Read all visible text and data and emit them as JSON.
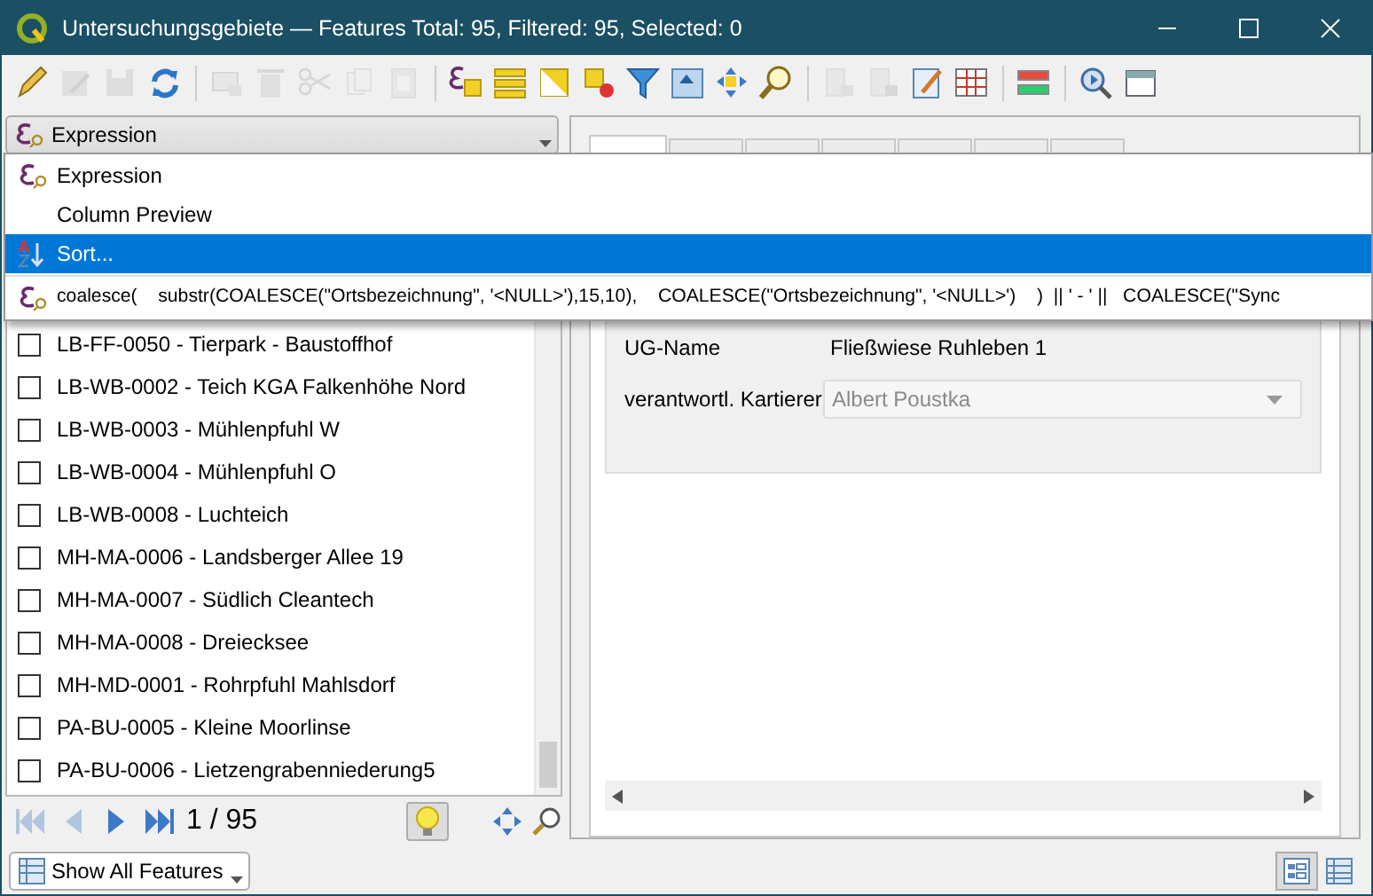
{
  "window": {
    "title": "Untersuchungsgebiete — Features Total: 95, Filtered: 95, Selected: 0"
  },
  "toolbar": [
    {
      "kind": "pencil",
      "disabled": false
    },
    {
      "kind": "edit",
      "disabled": true
    },
    {
      "kind": "save",
      "disabled": true
    },
    {
      "kind": "refresh",
      "disabled": false
    },
    {
      "kind": "sep"
    },
    {
      "kind": "add",
      "disabled": true
    },
    {
      "kind": "trash",
      "disabled": true
    },
    {
      "kind": "cut",
      "disabled": true
    },
    {
      "kind": "copy",
      "disabled": true
    },
    {
      "kind": "paste",
      "disabled": true
    },
    {
      "kind": "sep"
    },
    {
      "kind": "expr",
      "disabled": false
    },
    {
      "kind": "selall",
      "disabled": false
    },
    {
      "kind": "invert",
      "disabled": false
    },
    {
      "kind": "deselect",
      "disabled": false
    },
    {
      "kind": "filter",
      "disabled": false
    },
    {
      "kind": "top",
      "disabled": false
    },
    {
      "kind": "pan",
      "disabled": false
    },
    {
      "kind": "zoom",
      "disabled": false
    },
    {
      "kind": "sep"
    },
    {
      "kind": "newfield",
      "disabled": true
    },
    {
      "kind": "delfield",
      "disabled": true
    },
    {
      "kind": "calc",
      "disabled": false
    },
    {
      "kind": "grid",
      "disabled": false
    },
    {
      "kind": "sep"
    },
    {
      "kind": "cond",
      "disabled": false
    },
    {
      "kind": "sep"
    },
    {
      "kind": "actions",
      "disabled": false
    },
    {
      "kind": "dock",
      "disabled": false
    }
  ],
  "expression_combo": {
    "value": "Expression"
  },
  "menu": [
    {
      "kind": "expr",
      "label": "Expression",
      "selected": false
    },
    {
      "kind": "plain",
      "label": "Column Preview",
      "selected": false
    },
    {
      "kind": "sort",
      "label": "Sort...",
      "selected": true
    },
    {
      "kind": "expr",
      "label": "coalesce(    substr(COALESCE(\"Ortsbezeichnung\", '<NULL>'),15,10),    COALESCE(\"Ortsbezeichnung\", '<NULL>')    )  || ' - ' ||   COALESCE(\"Sync",
      "selected": false
    }
  ],
  "features": [
    {
      "label": "LB-FF-0050 - Tierpark - Baustoffhof",
      "checked": false
    },
    {
      "label": "LB-WB-0002 - Teich KGA Falkenhöhe Nord",
      "checked": false
    },
    {
      "label": "LB-WB-0003 - Mühlenpfuhl W",
      "checked": false
    },
    {
      "label": "LB-WB-0004 - Mühlenpfuhl O",
      "checked": false
    },
    {
      "label": "LB-WB-0008 - Luchteich",
      "checked": false
    },
    {
      "label": "MH-MA-0006 - Landsberger Allee 19",
      "checked": false
    },
    {
      "label": "MH-MA-0007 - Südlich Cleantech",
      "checked": false
    },
    {
      "label": "MH-MA-0008 - Dreiecksee",
      "checked": false
    },
    {
      "label": "MH-MD-0001 - Rohrpfuhl Mahlsdorf",
      "checked": false
    },
    {
      "label": "PA-BU-0005 - Kleine Moorlinse",
      "checked": false
    },
    {
      "label": "PA-BU-0006 - Lietzengrabenniederung5",
      "checked": false
    }
  ],
  "navigation": {
    "first_disabled": true,
    "prev_disabled": true,
    "position": "1 / 95",
    "highlight_on": true
  },
  "tabs": [
    {
      "selected": true
    },
    {
      "selected": false
    },
    {
      "selected": false
    },
    {
      "selected": false
    },
    {
      "selected": false
    },
    {
      "selected": false
    },
    {
      "selected": false
    }
  ],
  "form": {
    "fields": [
      {
        "kind": "text",
        "label": "UG-Name",
        "value": "Fließwiese Ruhleben 1",
        "disabled": false
      },
      {
        "kind": "combo",
        "label": "verantwortl. Kartierer",
        "value": "Albert Poustka",
        "disabled": true
      }
    ]
  },
  "filter_button": {
    "label": "Show All Features"
  },
  "view_buttons": [
    {
      "kind": "form",
      "selected": true
    },
    {
      "kind": "table",
      "selected": false
    }
  ]
}
